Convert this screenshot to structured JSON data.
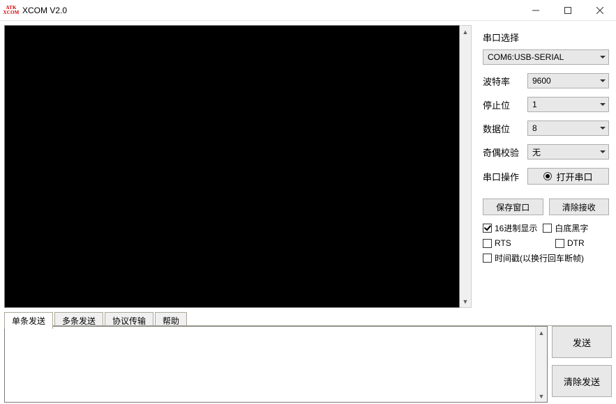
{
  "window": {
    "title": "XCOM V2.0",
    "icon_text_top": "ATK",
    "icon_text_bottom": "XCOM"
  },
  "serial": {
    "section_label": "串口选择",
    "port_value": "COM6:USB-SERIAL",
    "rows": {
      "baud": {
        "label": "波特率",
        "value": "9600"
      },
      "stop": {
        "label": "停止位",
        "value": "1"
      },
      "data": {
        "label": "数据位",
        "value": "8"
      },
      "parity": {
        "label": "奇偶校验",
        "value": "无"
      },
      "op": {
        "label": "串口操作",
        "button": "打开串口"
      }
    },
    "buttons": {
      "save_window": "保存窗口",
      "clear_recv": "清除接收"
    },
    "checks": {
      "hex_display": "16进制显示",
      "white_bg": "白底黑字",
      "rts": "RTS",
      "dtr": "DTR",
      "timestamp": "时间戳(以换行回车断帧)"
    }
  },
  "tabs": {
    "single": "单条发送",
    "multi": "多条发送",
    "proto": "协议传输",
    "help": "帮助"
  },
  "send": {
    "send_btn": "发送",
    "clear_btn": "清除发送"
  }
}
